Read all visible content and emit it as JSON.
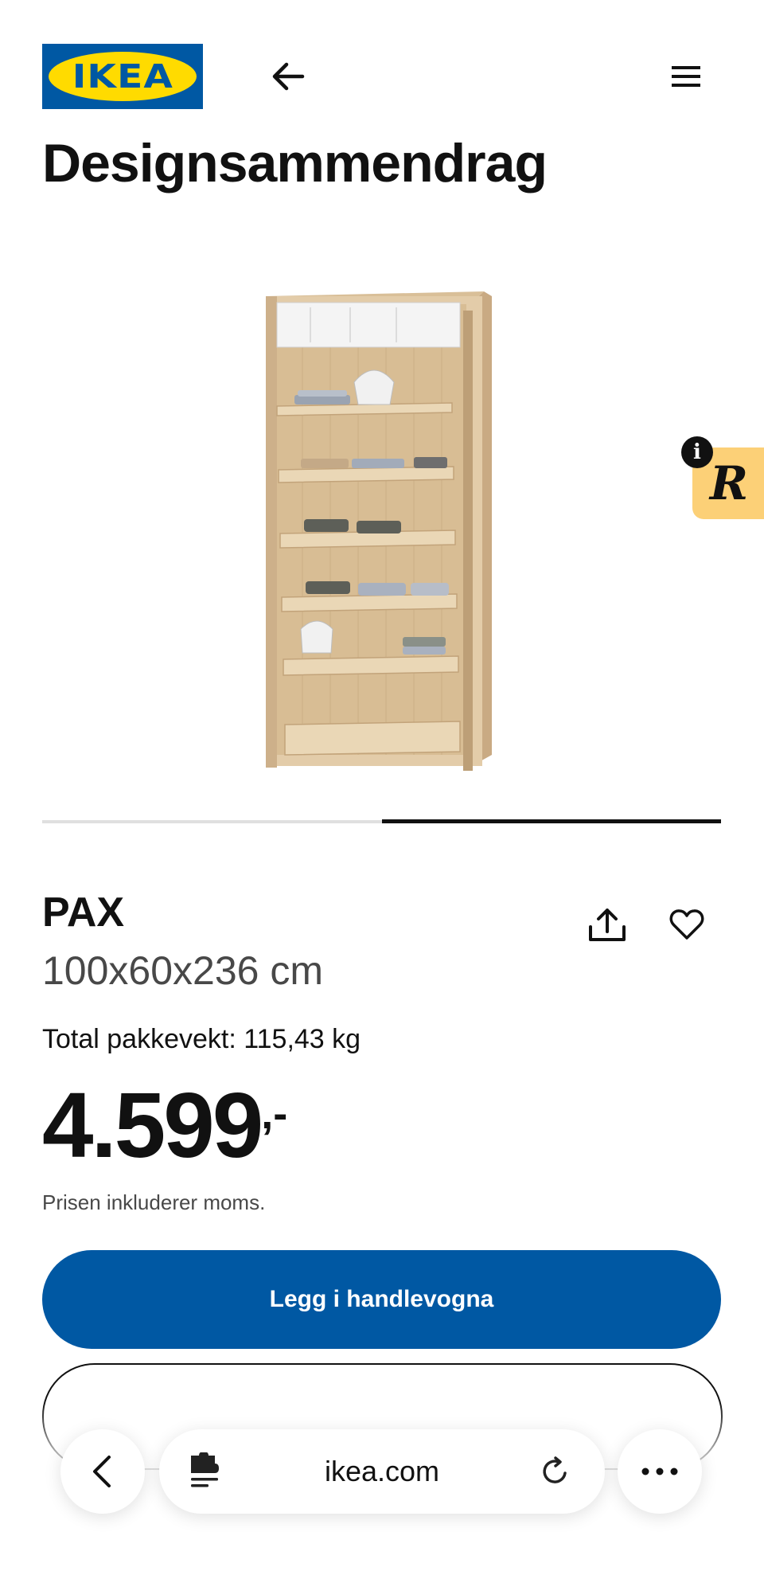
{
  "header": {
    "logo_text": "IKEA",
    "icons": {
      "back": "arrow-left-icon",
      "menu": "hamburger-menu-icon"
    }
  },
  "page": {
    "title": "Designsammendrag"
  },
  "gallery": {
    "image_name": "pax-wardrobe-image",
    "active_slide": 2,
    "slide_count": 2
  },
  "product": {
    "name": "PAX",
    "dimensions": "100x60x236 cm",
    "weight": "Total pakkevekt: 115,43 kg",
    "price_main": "4.599",
    "price_suffix": ",-",
    "vat_note": "Prisen inkluderer moms.",
    "icons": {
      "share": "share-icon",
      "favorite": "heart-icon"
    }
  },
  "actions": {
    "add_to_cart": "Legg i handlevogna"
  },
  "extension_badge": {
    "letter": "R",
    "info": "i"
  },
  "browser": {
    "url": "ikea.com",
    "icons": {
      "back": "chevron-left-icon",
      "site": "puzzle-icon",
      "reload": "reload-icon",
      "more": "more-icon"
    }
  },
  "colors": {
    "brand_blue": "#0058a3",
    "brand_yellow": "#ffdb00",
    "badge_yellow": "#fcd077"
  }
}
